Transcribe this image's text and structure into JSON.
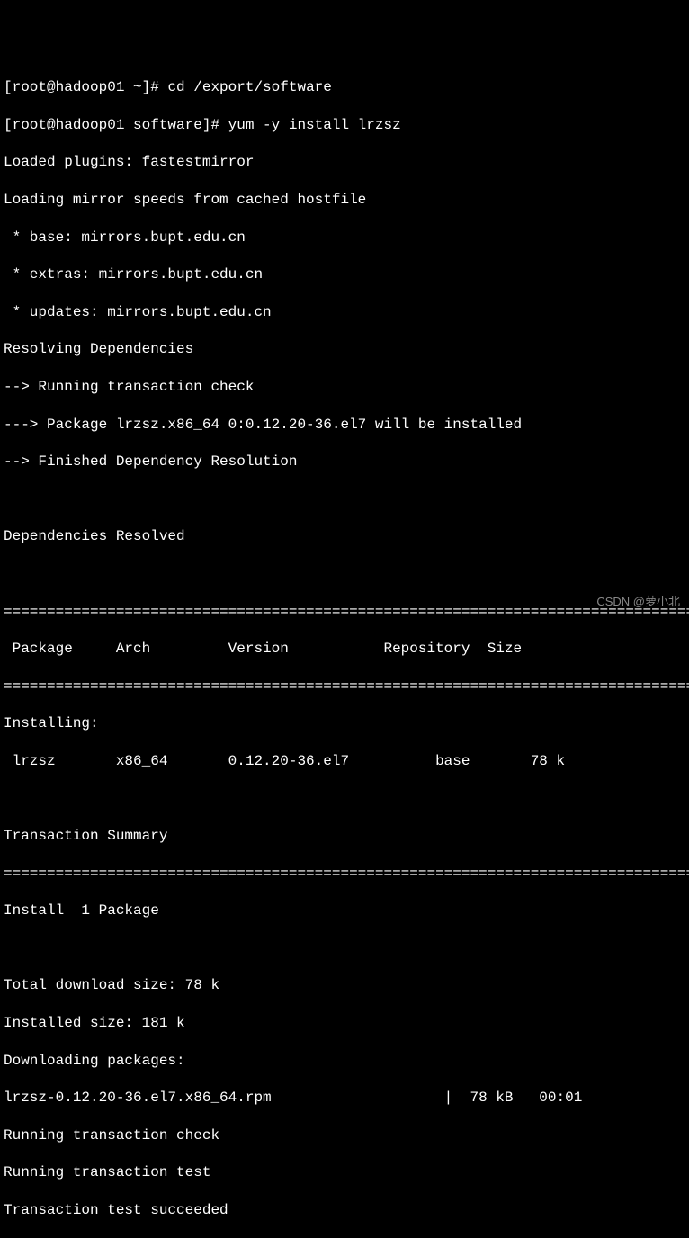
{
  "prompt1": {
    "prefix": "[root@hadoop01 ~]# ",
    "cmd": "cd /export/software"
  },
  "prompt2": {
    "prefix": "[root@hadoop01 software]# ",
    "cmd": "yum -y install lrzsz"
  },
  "output": {
    "loaded_plugins": "Loaded plugins: fastestmirror",
    "loading_mirror": "Loading mirror speeds from cached hostfile",
    "mirror_base": " * base: mirrors.bupt.edu.cn",
    "mirror_extras": " * extras: mirrors.bupt.edu.cn",
    "mirror_updates": " * updates: mirrors.bupt.edu.cn",
    "resolving": "Resolving Dependencies",
    "trans_check": "--> Running transaction check",
    "pkg_install": "---> Package lrzsz.x86_64 0:0.12.20-36.el7 will be installed",
    "finished": "--> Finished Dependency Resolution",
    "deps_resolved": "Dependencies Resolved",
    "sep": "================================================================================",
    "header": " Package     Arch         Version           Repository  Size",
    "installing_label": "Installing:",
    "pkg_row": " lrzsz       x86_64       0.12.20-36.el7          base       78 k",
    "trans_summary": "Transaction Summary",
    "install_count": "Install  1 Package",
    "total_download": "Total download size: 78 k",
    "installed_size": "Installed size: 181 k",
    "downloading": "Downloading packages:",
    "rpm_line": "lrzsz-0.12.20-36.el7.x86_64.rpm                    |  78 kB   00:01",
    "run_trans_check": "Running transaction check",
    "run_trans_test": "Running transaction test",
    "trans_test_succeeded": "Transaction test succeeded"
  },
  "watermark": "CSDN @萝小北"
}
